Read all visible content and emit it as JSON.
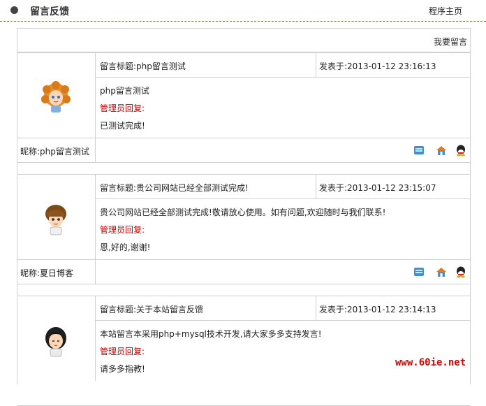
{
  "header": {
    "title": "留言反馈",
    "home_link": "程序主页"
  },
  "board": {
    "write_link": "我要留言"
  },
  "entries": [
    {
      "subject": "留言标题:php留言测试",
      "date": "发表于:2013-01-12 23:16:13",
      "content": "php留言测试",
      "admin_label": "管理员回复:",
      "reply": "已测试完成!",
      "nickname": "昵称:php留言测试",
      "avatar": "curly-orange-hair-girl-avatar"
    },
    {
      "subject": "留言标题:贵公司网站已经全部测试完成!",
      "date": "发表于:2013-01-12 23:15:07",
      "content": "贵公司网站已经全部测试完成!敬请放心使用。如有问题,欢迎随时与我们联系!",
      "admin_label": "管理员回复:",
      "reply": "恩,好的,谢谢!",
      "nickname": "昵称:夏日博客",
      "avatar": "brown-hair-boy-avatar"
    },
    {
      "subject": "留言标题:关于本站留言反馈",
      "date": "发表于:2013-01-12 23:14:13",
      "content": "本站留言本采用php+mysql技术开发,请大家多多支持发言!",
      "admin_label": "管理员回复:",
      "reply": "请多多指教!",
      "nickname": "",
      "avatar": "black-hair-girl-avatar"
    }
  ],
  "icons": [
    "email-icon",
    "home-icon",
    "qq-icon"
  ],
  "watermark": "www.60ie.net",
  "colors": {
    "admin_label": "#c00000",
    "watermark": "#e00000",
    "border": "#cfcfcf"
  }
}
